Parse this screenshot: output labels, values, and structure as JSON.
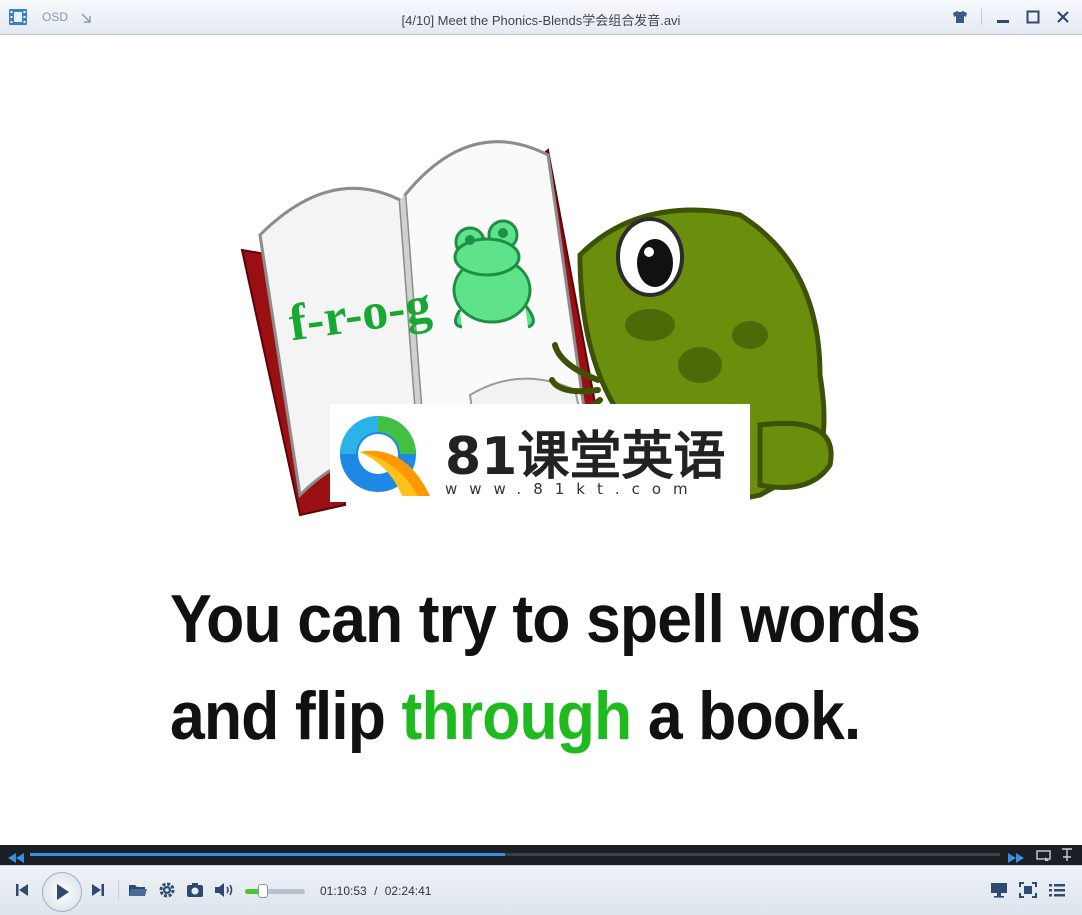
{
  "window": {
    "osd_label": "OSD",
    "title": "[4/10] Meet the Phonics-Blends学会组合发音.avi"
  },
  "video": {
    "book_word": "f-r-o-g",
    "caption_line1": "You can try to spell words",
    "caption_line2_pre": "and flip",
    "caption_line2_highlight": "through",
    "caption_line2_post": "a book.",
    "watermark_name": "81课堂英语",
    "watermark_url": "www.81kt.com"
  },
  "playback": {
    "current_time": "01:10:53",
    "separator": "/",
    "total_time": "02:24:41",
    "progress": 0.49,
    "volume": 0.3
  },
  "colors": {
    "accent": "#3b8fe0",
    "volume": "#4cc43a",
    "highlight_text": "#1fba1f"
  }
}
